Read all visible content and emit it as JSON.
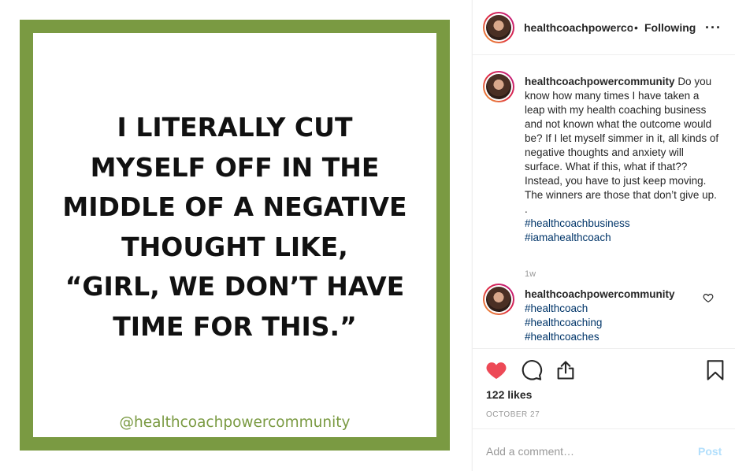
{
  "image": {
    "quote_lines": "I LITERALLY CUT\nMYSELF OFF IN THE\nMIDDLE OF A NEGATIVE\nTHOUGHT LIKE,\n“GIRL, WE DON’T HAVE\nTIME FOR THIS.”",
    "handle": "@healthcoachpowercommunity",
    "frame_color": "#7a9a42"
  },
  "header": {
    "username": "healthcoachpowercommunity",
    "separator": "•",
    "follow_status": "Following",
    "more_icon": "more-horizontal-icon"
  },
  "caption": {
    "username": "healthcoachpowercommunity",
    "text": "Do you know how many times I have taken a leap with my health coaching business and not known what the outcome would be? If I let myself simmer in it, all kinds of negative thoughts and anxiety will surface. What if this, what if that?? Instead, you have to just keep moving. The winners are those that don’t give up.",
    "dot": ".",
    "hashtags": [
      "#healthcoachbusiness",
      "#iamahealthcoach"
    ],
    "time": "1w"
  },
  "comment": {
    "username": "healthcoachpowercommunity",
    "hashtags": [
      "#healthcoach",
      "#healthcoaching",
      "#healthcoaches"
    ]
  },
  "actions": {
    "likes": "122 likes",
    "date": "OCTOBER 27",
    "like_color": "#ed4956"
  },
  "comment_box": {
    "placeholder": "Add a comment…",
    "post_label": "Post"
  }
}
